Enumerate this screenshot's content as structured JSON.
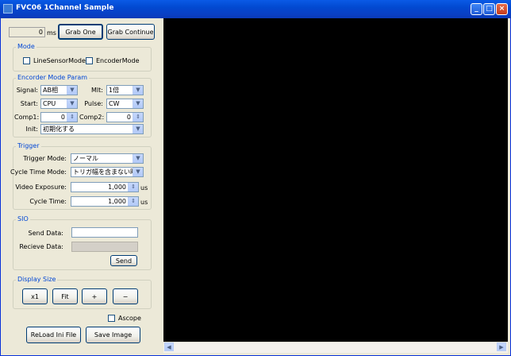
{
  "window": {
    "title": "FVC06 1Channel Sample"
  },
  "top": {
    "ms_value": "0",
    "ms_unit": "ms",
    "grab_one": "Grab One",
    "grab_continue": "Grab Continue"
  },
  "mode": {
    "title": "Mode",
    "line_sensor": "LineSensorMode",
    "encoder": "EncoderMode"
  },
  "encoder": {
    "title": "Encorder Mode Param",
    "signal_label": "Signal:",
    "signal_value": "AB相",
    "mlt_label": "Mlt:",
    "mlt_value": "1倍",
    "start_label": "Start:",
    "start_value": "CPU",
    "pulse_label": "Pulse:",
    "pulse_value": "CW",
    "comp1_label": "Comp1:",
    "comp1_value": "0",
    "comp2_label": "Comp2:",
    "comp2_value": "0",
    "init_label": "Init:",
    "init_value": "初期化する"
  },
  "trigger": {
    "title": "Trigger",
    "mode_label": "Trigger Mode:",
    "mode_value": "ノーマル",
    "cycle_mode_label": "Cycle Time Mode:",
    "cycle_mode_value": "トリガ幅を含まない時間",
    "exposure_label": "Video Exposure:",
    "exposure_value": "1,000",
    "exposure_unit": "us",
    "cycle_label": "Cycle Time:",
    "cycle_value": "1,000",
    "cycle_unit": "us"
  },
  "sio": {
    "title": "SIO",
    "send_label": "Send Data:",
    "send_value": "",
    "recv_label": "Recieve Data:",
    "recv_value": "",
    "send_button": "Send"
  },
  "display": {
    "title": "Display Size",
    "x1": "x1",
    "fit": "Fit",
    "plus": "+",
    "minus": "−"
  },
  "ascope": "Ascope",
  "bottom": {
    "reload": "ReLoad Ini File",
    "save": "Save Image"
  },
  "icons": {
    "minimize": "minimize-icon",
    "maximize": "maximize-icon",
    "close": "close-icon"
  }
}
